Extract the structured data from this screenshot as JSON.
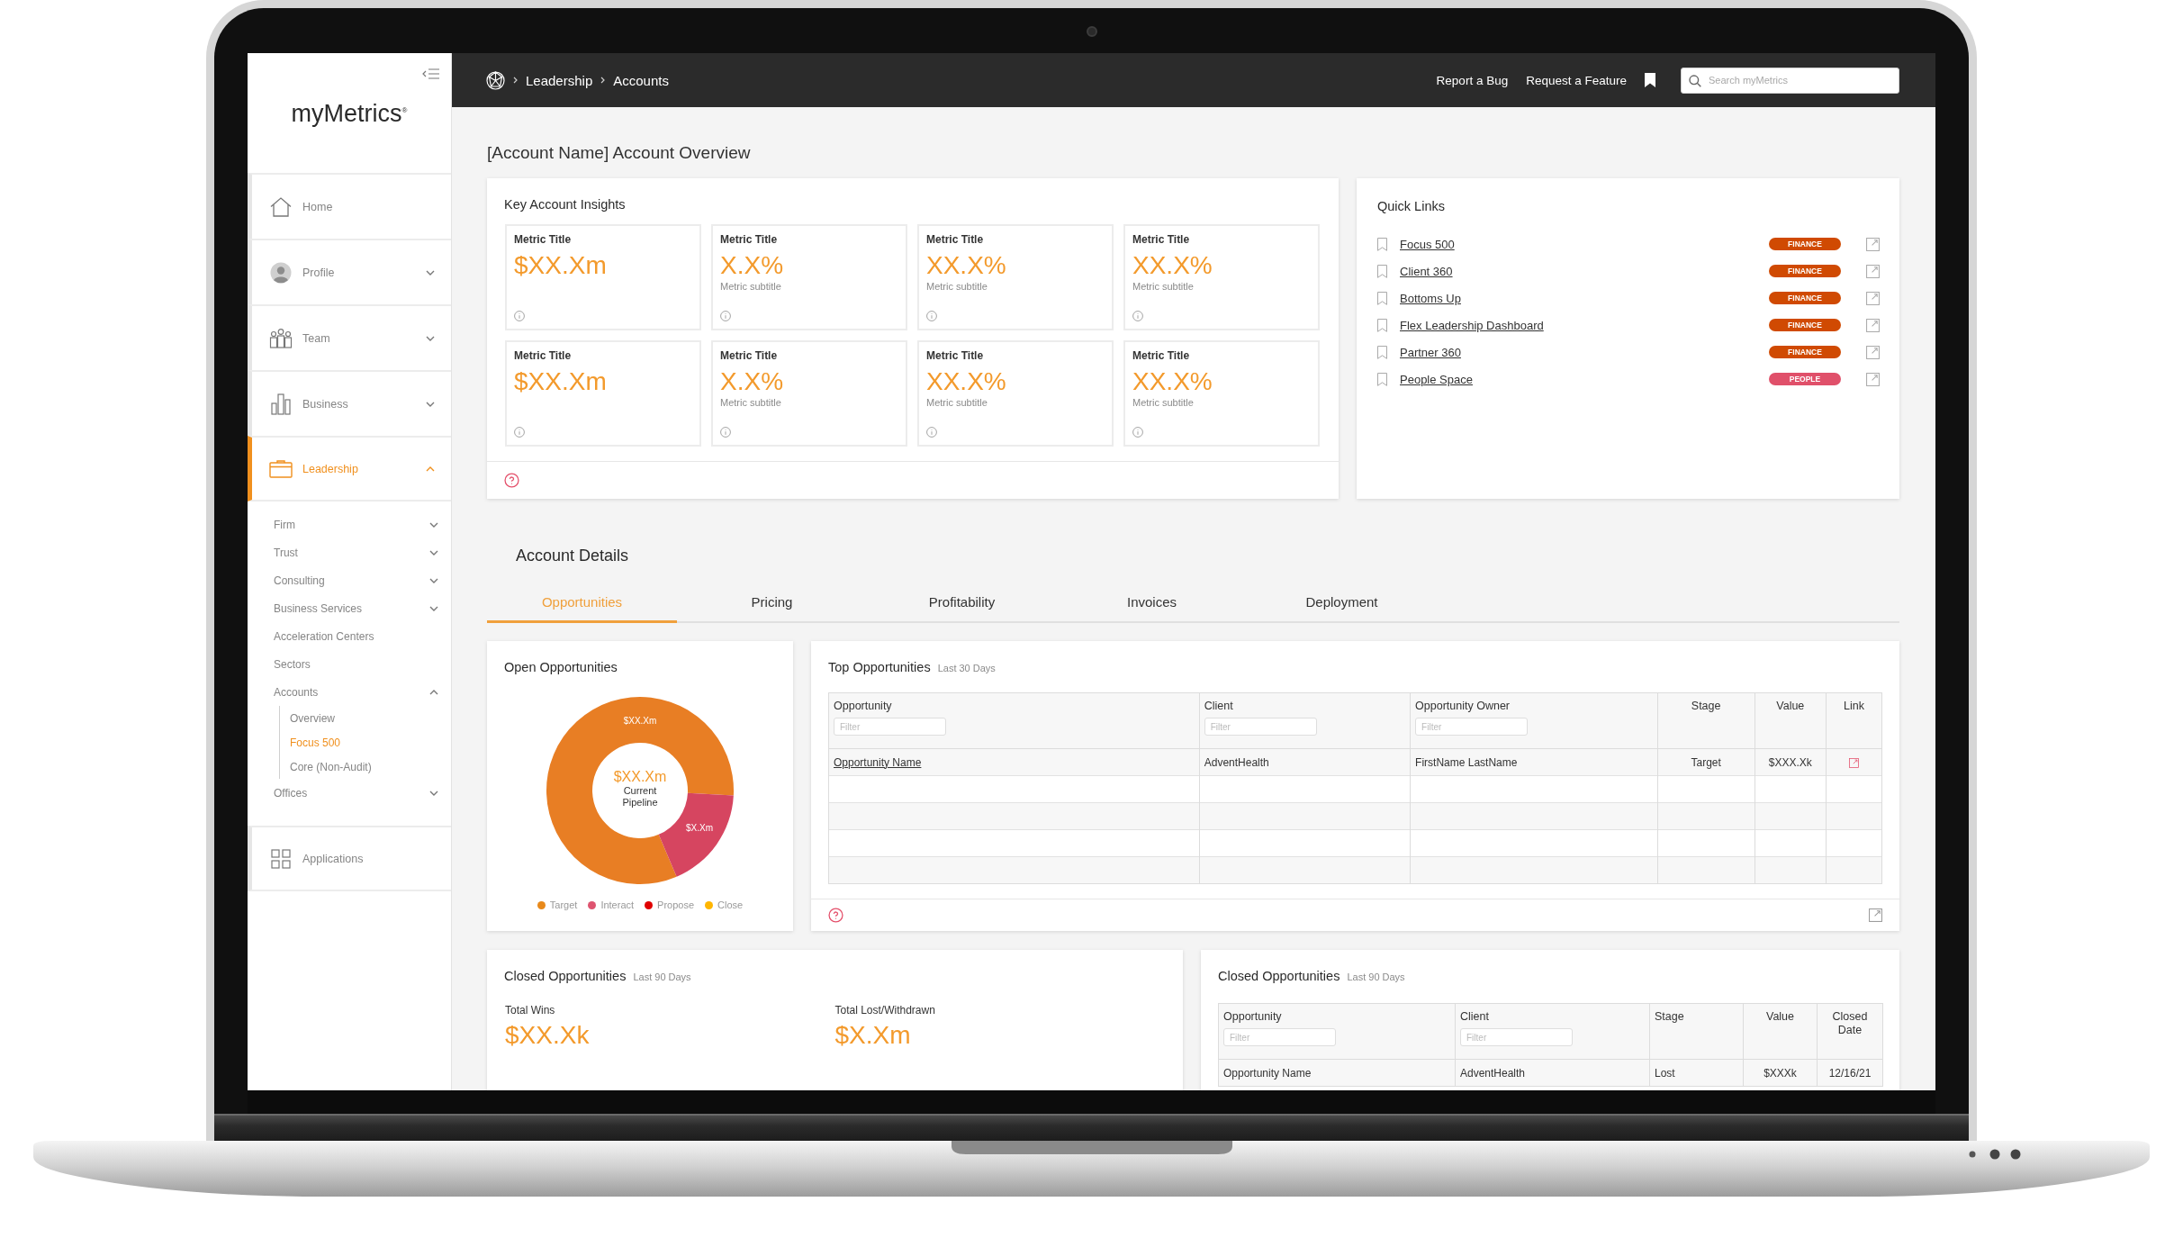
{
  "sidebar": {
    "logo": "myMetrics$^{®}$",
    "items": [
      {
        "label": "Home",
        "selected": false
      },
      {
        "label": "Profile",
        "selected": false,
        "expanded": false
      },
      {
        "label": "Team",
        "selected": false,
        "expanded": false
      },
      {
        "label": "Business",
        "selected": false,
        "expanded": false
      },
      {
        "label": "Leadership",
        "selected": true,
        "expanded": true,
        "children": [
          {
            "label": "Firm",
            "selected": false,
            "expanded": false
          },
          {
            "label": "Trust",
            "selected": false,
            "expanded": false
          },
          {
            "label": "Consulting",
            "selected": false,
            "expanded": false
          },
          {
            "label": "Business Services",
            "selected": false,
            "expanded": false
          },
          {
            "label": "Acceleration Centers",
            "selected": false
          },
          {
            "label": "Sectors",
            "selected": false
          },
          {
            "label": "Accounts",
            "selected": false,
            "expanded": true,
            "children": [
              {
                "label": "Overview",
                "selected": false
              },
              {
                "label": "Focus 500",
                "selected": true
              },
              {
                "label": "Core (Non-Audit)",
                "selected": false
              }
            ]
          },
          {
            "label": "Offices",
            "selected": false,
            "expanded": false
          }
        ]
      },
      {
        "label": "Applications",
        "selected": false
      }
    ]
  },
  "top_bar": {
    "breadcrumbs": [
      "Leadership",
      "Accounts"
    ],
    "links": [
      "Report a Bug",
      "Request a Feature"
    ],
    "search": {
      "placeholder": "Search myMetrics"
    }
  },
  "page_title": "[Account Name] Account Overview",
  "insights": {
    "title": "Key Account Insights",
    "metrics": [
      {
        "title": "Metric Title",
        "value": "$XX.Xm"
      },
      {
        "title": "Metric Title",
        "value": "X.X%",
        "subtitle": "Metric subtitle"
      },
      {
        "title": "Metric Title",
        "value": "XX.X%",
        "subtitle": "Metric subtitle"
      },
      {
        "title": "Metric Title",
        "value": "XX.X%",
        "subtitle": "Metric subtitle"
      },
      {
        "title": "Metric Title",
        "value": "$XX.Xm"
      },
      {
        "title": "Metric Title",
        "value": "X.X%",
        "subtitle": "Metric subtitle"
      },
      {
        "title": "Metric Title",
        "value": "XX.X%",
        "subtitle": "Metric subtitle"
      },
      {
        "title": "Metric Title",
        "value": "XX.X%",
        "subtitle": "Metric subtitle"
      }
    ]
  },
  "quick_links": {
    "title": "Quick Links",
    "items": [
      {
        "label": "Focus 500",
        "tag": "FINANCE",
        "color": "#d04a02"
      },
      {
        "label": "Client 360",
        "tag": "FINANCE",
        "color": "#d04a02"
      },
      {
        "label": "Bottoms Up",
        "tag": "FINANCE",
        "color": "#d04a02"
      },
      {
        "label": "Flex Leadership Dashboard",
        "tag": "FINANCE",
        "color": "#d04a02"
      },
      {
        "label": "Partner 360",
        "tag": "FINANCE",
        "color": "#d04a02"
      },
      {
        "label": "People Space",
        "tag": "PEOPLE",
        "color": "#e0506a"
      }
    ]
  },
  "account_details": {
    "title": "Account Details",
    "tabs": [
      {
        "label": "Opportunities",
        "selected": true
      },
      {
        "label": "Pricing",
        "selected": false
      },
      {
        "label": "Profitability",
        "selected": false
      },
      {
        "label": "Invoices",
        "selected": false
      },
      {
        "label": "Deployment",
        "selected": false
      }
    ]
  },
  "open_opportunities": {
    "title": "Open Opportunities",
    "center_value": "$XX.Xm",
    "center_label": "Current Pipeline",
    "slices": [
      {
        "label": "$XX.Xm",
        "color": "#e87e24"
      },
      {
        "label": "$X.Xm",
        "color": "#d64560"
      }
    ],
    "legend": [
      {
        "label": "Target",
        "color": "#e8891a"
      },
      {
        "label": "Interact",
        "color": "#de5470"
      },
      {
        "label": "Propose",
        "color": "#e00000"
      },
      {
        "label": "Close",
        "color": "#ffb600"
      }
    ]
  },
  "top_opportunities": {
    "title": "Top Opportunities",
    "subtitle": "Last 30 Days",
    "columns": [
      {
        "label": "Opportunity",
        "kind": "link",
        "filter": {
          "placeholder": "Filter"
        }
      },
      {
        "label": "Client",
        "kind": "text",
        "filter": {
          "placeholder": "Filter"
        }
      },
      {
        "label": "Opportunity Owner",
        "kind": "text",
        "filter": {
          "placeholder": "Filter"
        }
      },
      {
        "label": "Stage",
        "kind": "text"
      },
      {
        "label": "Value",
        "kind": "text"
      },
      {
        "label": "Link",
        "kind": "icon"
      }
    ],
    "rows": [
      {
        "cells": [
          "Opportunity Name",
          "AdventHealth",
          "FirstName LastName",
          "Target",
          "$XXX.Xk"
        ]
      }
    ]
  },
  "closed_summary": {
    "title": "Closed Opportunities",
    "subtitle": "Last 90 Days",
    "stats": [
      {
        "label": "Total Wins",
        "value": "$XX.Xk"
      },
      {
        "label": "Total Lost/Withdrawn",
        "value": "$X.Xm"
      }
    ]
  },
  "closed_table": {
    "title": "Closed Opportunities",
    "subtitle": "Last 90 Days",
    "columns": [
      {
        "label": "Opportunity",
        "kind": "text",
        "filter": {
          "placeholder": "Filter"
        }
      },
      {
        "label": "Client",
        "kind": "text",
        "filter": {
          "placeholder": "Filter"
        }
      },
      {
        "label": "Stage",
        "kind": "text"
      },
      {
        "label": "Value",
        "kind": "text"
      },
      {
        "label": "Closed Date",
        "kind": "text"
      }
    ],
    "rows": [
      {
        "cells": [
          "Opportunity Name",
          "AdventHealth",
          "Lost",
          "$XXXk",
          "12/16/21"
        ]
      }
    ]
  }
}
